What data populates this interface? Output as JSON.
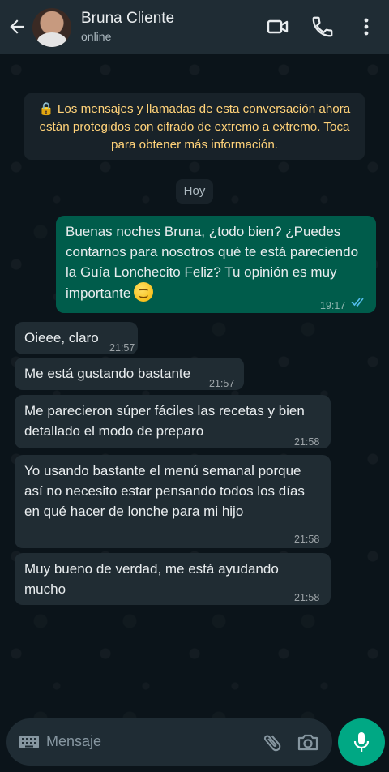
{
  "header": {
    "contact_name": "Bruna Cliente",
    "status": "online"
  },
  "chat": {
    "encryption_notice": "🔒 Los mensajes y llamadas de esta conversación ahora están protegidos con cifrado de extremo a extremo. Toca para obtener más información.",
    "date_chip": "Hoy",
    "messages": [
      {
        "direction": "out",
        "text": "Buenas noches Bruna, ¿todo bien? ¿Puedes contarnos para nosotros qué te está pareciendo la Guía Lonchecito Feliz? Tu opinión es muy importante",
        "emoji": "smiling-face",
        "time": "19:17",
        "ticks": "read"
      },
      {
        "direction": "in",
        "text": "Oieee, claro",
        "time": "21:57"
      },
      {
        "direction": "in",
        "text": "Me está gustando bastante",
        "time": "21:57"
      },
      {
        "direction": "in",
        "text": "Me parecieron súper fáciles las recetas y bien detallado el modo de preparo",
        "time": "21:58"
      },
      {
        "direction": "in",
        "text": "Yo usando bastante el menú semanal porque así no necesito estar pensando todos los días en qué hacer de lonche para mi hijo",
        "time": "21:58"
      },
      {
        "direction": "in",
        "text": "Muy bueno de verdad, me está ayudando mucho",
        "time": "21:58"
      }
    ]
  },
  "input": {
    "placeholder": "Mensaje"
  },
  "colors": {
    "header_bg": "#1f2c34",
    "chat_bg": "#0b141a",
    "outgoing_bubble": "#005c4b",
    "incoming_bubble": "#202c33",
    "accent": "#00a884",
    "notice_text": "#ffd279",
    "read_ticks": "#53bdeb"
  }
}
